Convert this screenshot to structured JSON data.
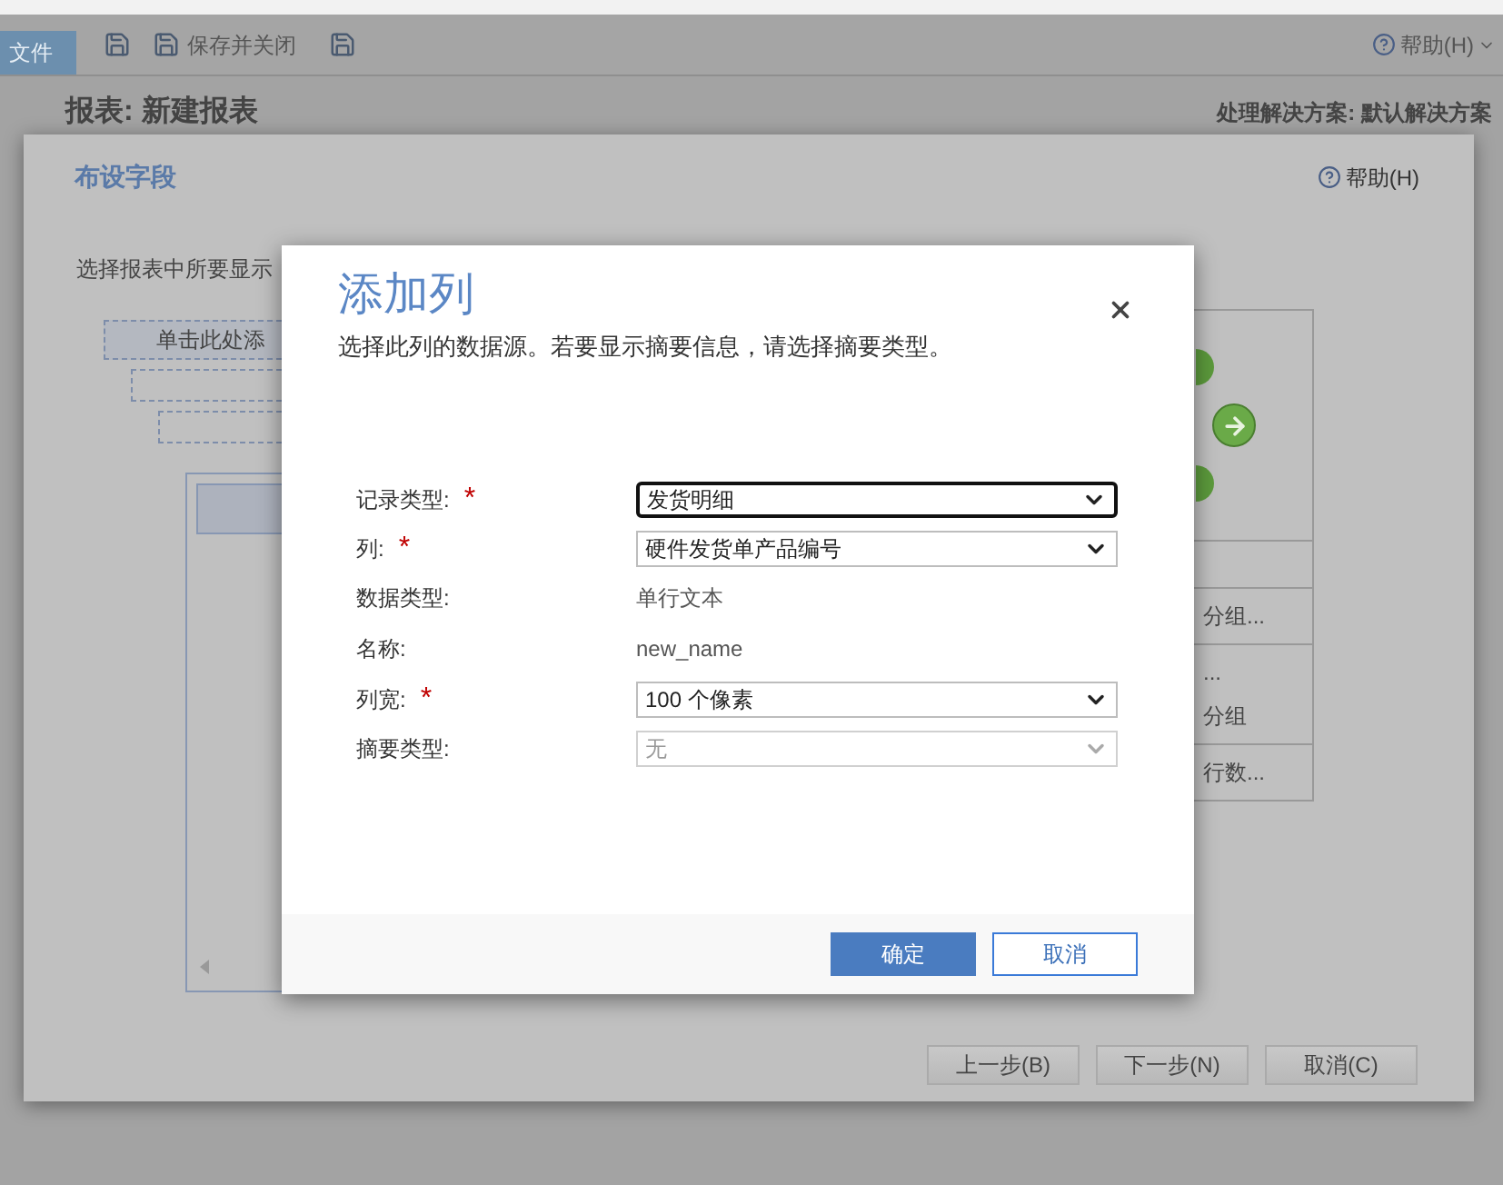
{
  "app": {
    "file_tab": "文件",
    "save_close": "保存并关闭",
    "help": "帮助(H)",
    "page_title": "报表: 新建报表",
    "solution": "处理解决方案: 默认解决方案"
  },
  "wizard": {
    "title": "布设字段",
    "help": "帮助(H)",
    "instruction": "选择报表中所要显示",
    "add_here": "单击此处添",
    "side_sections": [
      {
        "lines": [
          "分组..."
        ]
      },
      {
        "lines": [
          "...",
          "分组"
        ]
      },
      {
        "lines": [
          "行数..."
        ]
      }
    ],
    "buttons": [
      "上一步(B)",
      "下一步(N)",
      "取消(C)"
    ]
  },
  "dialog": {
    "title": "添加列",
    "subtitle": "选择此列的数据源。若要显示摘要信息，请选择摘要类型。",
    "fields": [
      {
        "kind": "select",
        "label": "记录类型:",
        "required_mark": "*",
        "value": "发货明细",
        "focused": true,
        "disabled": false
      },
      {
        "kind": "select",
        "label": "列:",
        "required_mark": "*",
        "value": "硬件发货单产品编号",
        "focused": false,
        "disabled": false
      },
      {
        "kind": "text",
        "label": "数据类型:",
        "value": "单行文本"
      },
      {
        "kind": "text",
        "label": "名称:",
        "value": "new_name"
      },
      {
        "kind": "select",
        "label": "列宽:",
        "required_mark": "*",
        "value": "100 个像素",
        "focused": false,
        "disabled": false
      },
      {
        "kind": "select",
        "label": "摘要类型:",
        "value": "无",
        "focused": false,
        "disabled": true
      }
    ],
    "buttons": [
      {
        "label": "确定",
        "primary": true
      },
      {
        "label": "取消",
        "primary": false
      }
    ]
  }
}
